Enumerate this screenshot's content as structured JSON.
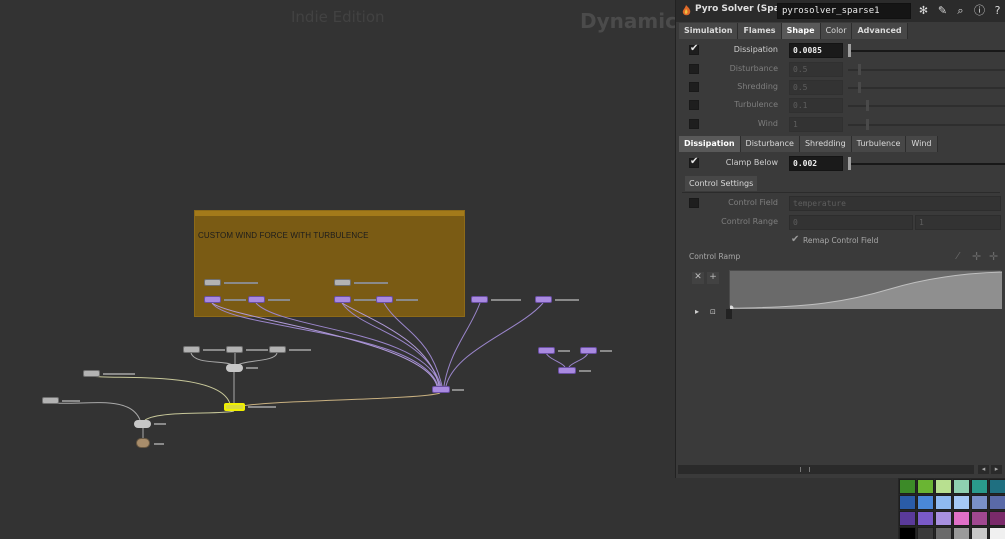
{
  "network": {
    "edition_watermark": "Indie Edition",
    "context_watermark": "Dynamics",
    "sticky_note_title": "CUSTOM WIND FORCE WITH TURBULENCE"
  },
  "params": {
    "node_type": "Pyro Solver (Sparse)",
    "node_name": "pyrosolver_sparse1",
    "main_tabs": [
      "Simulation",
      "Flames",
      "Shape",
      "Color",
      "Advanced"
    ],
    "active_main_tab": "Shape",
    "shape_rows": [
      {
        "label": "Dissipation",
        "value": "0.0085",
        "enabled": true
      },
      {
        "label": "Disturbance",
        "value": "0.5",
        "enabled": false
      },
      {
        "label": "Shredding",
        "value": "0.5",
        "enabled": false
      },
      {
        "label": "Turbulence",
        "value": "0.1",
        "enabled": false
      },
      {
        "label": "Wind",
        "value": "1",
        "enabled": false
      }
    ],
    "sub_tabs": [
      "Dissipation",
      "Disturbance",
      "Shredding",
      "Turbulence",
      "Wind"
    ],
    "active_sub_tab": "Dissipation",
    "clamp_below": {
      "label": "Clamp Below",
      "value": "0.002",
      "enabled": true
    },
    "control_settings_label": "Control Settings",
    "control_field": {
      "label": "Control Field",
      "placeholder": "temperature"
    },
    "control_range": {
      "label": "Control Range",
      "min": "0",
      "max": "1"
    },
    "remap_control_field": {
      "label": "Remap Control Field",
      "checked": true
    },
    "control_ramp_label": "Control Ramp"
  },
  "palette": {
    "colors": [
      [
        "#3c8a28",
        "#6ab533",
        "#b8e090",
        "#8fd0b0",
        "#2a9b8c",
        "#1f6f80"
      ],
      [
        "#2a5ca8",
        "#4a88d8",
        "#8fbaf0",
        "#a5c8f5",
        "#7a90c8",
        "#5a6aa8"
      ],
      [
        "#5a3a9a",
        "#7a5ac8",
        "#a890e0",
        "#e070c8",
        "#a04890",
        "#7a2a6a"
      ],
      [
        "#000000",
        "#3a3a3a",
        "#6a6a6a",
        "#9a9a9a",
        "#c8c8c8",
        "#f0f0f0"
      ]
    ]
  }
}
